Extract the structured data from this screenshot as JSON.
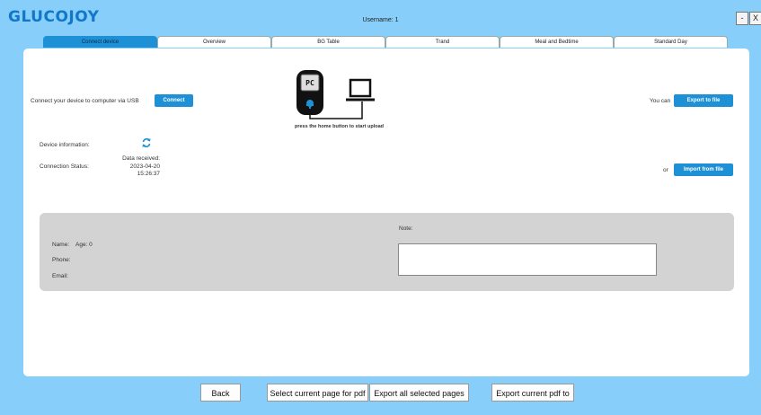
{
  "app": {
    "logo": "GLUCOJOY",
    "username": "Username: 1"
  },
  "window": {
    "minimize": "-",
    "close": "X"
  },
  "tabs": [
    "Connect device",
    "Overview",
    "BG Table",
    "Trand",
    "Meal and Bedtime",
    "Standard Day"
  ],
  "connect": {
    "prompt": "Connect your device to computer via USB",
    "button": "Connect",
    "device_info_label": "Device information:",
    "connection_status_label": "Connection Status:",
    "data_received_label": "Data received:",
    "date": "2023-04-20",
    "time": "15:26:37",
    "instruction": "press the home button to start upload",
    "meter_screen": "PC"
  },
  "export": {
    "you_can": "You can",
    "export_button": "Export to file",
    "or": "or",
    "import_button": "Import from file"
  },
  "patient": {
    "name_label": "Name:",
    "age": "Age: 0",
    "phone_label": "Phone:",
    "email_label": "Email:",
    "note_label": "Note:"
  },
  "bottom": {
    "back": "Back",
    "select_page": "Select current page for pdf",
    "export_all": "Export all selected pages",
    "export_current": "Export current pdf to"
  },
  "colors": {
    "background": "#87cefa",
    "accent": "#1e90d6",
    "logo": "#1178c9"
  },
  "icons": {
    "refresh": "refresh-icon",
    "meter": "glucose-meter-icon",
    "laptop": "laptop-icon"
  }
}
